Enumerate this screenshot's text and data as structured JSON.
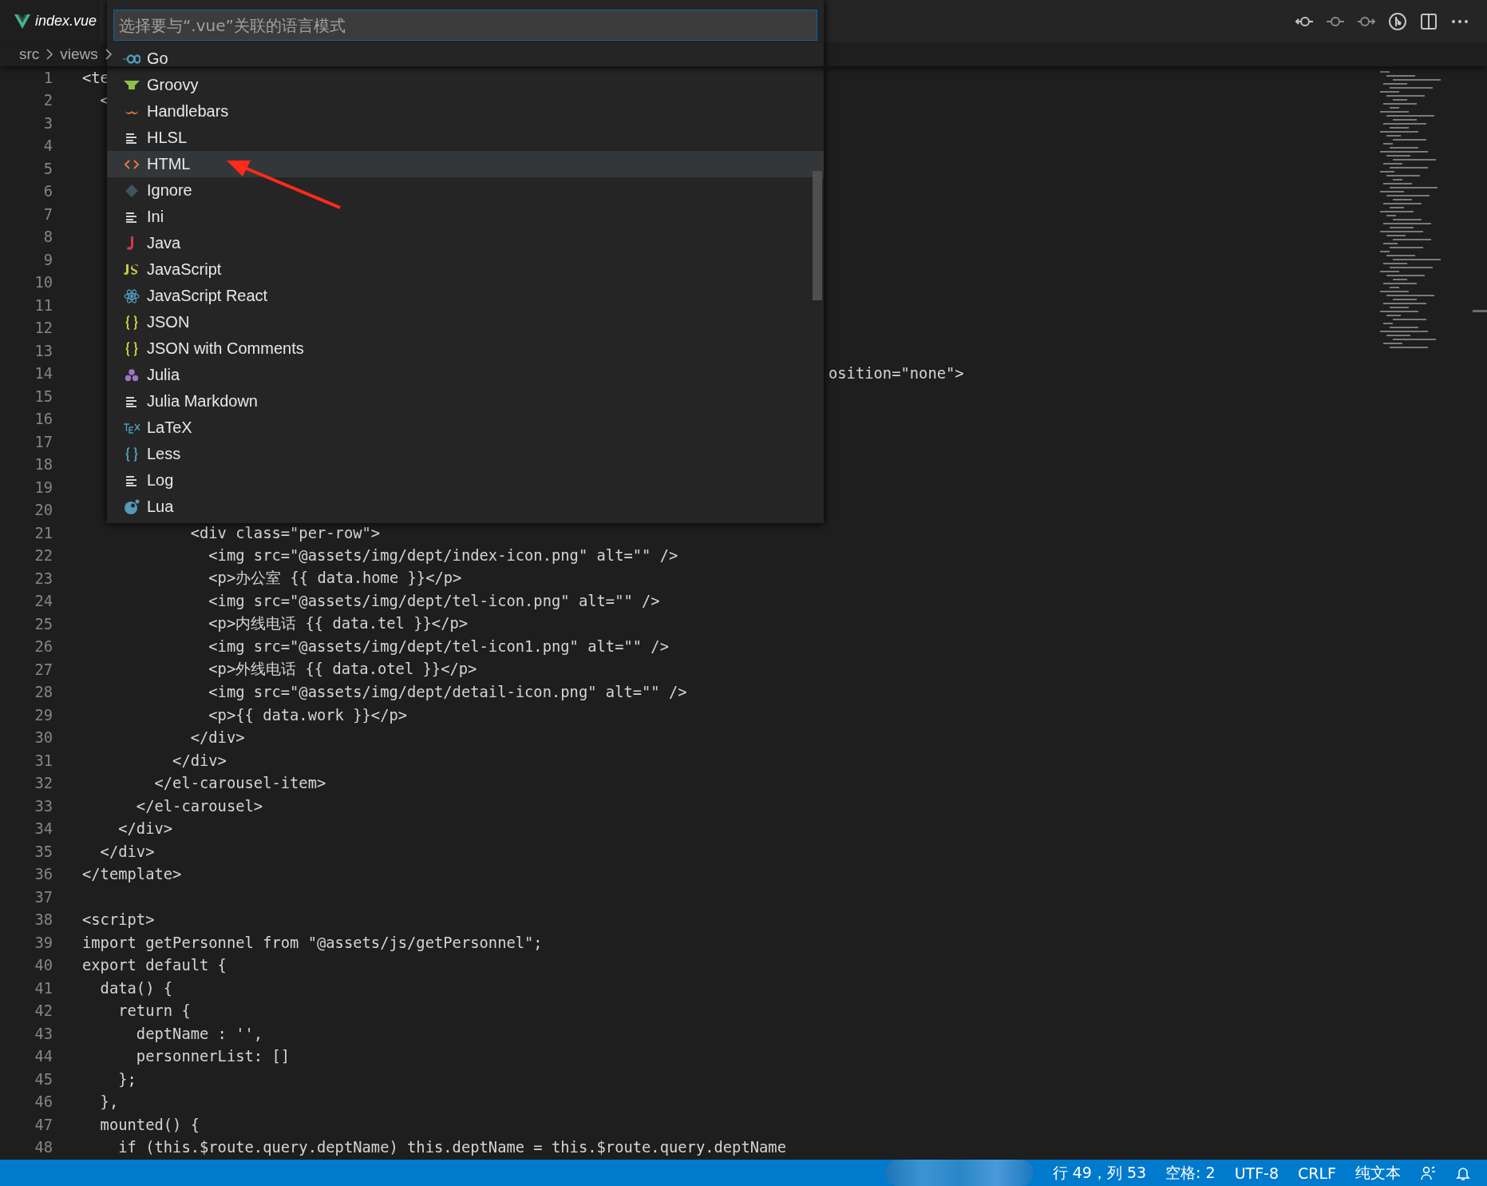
{
  "tab": {
    "title": "index.vue"
  },
  "breadcrumb": [
    "src",
    "views"
  ],
  "language_picker": {
    "placeholder": "选择要与“.vue”关联的语言模式",
    "items": [
      {
        "label": "Go",
        "kind": "go",
        "selected": false
      },
      {
        "label": "Groovy",
        "kind": "groovy",
        "selected": false
      },
      {
        "label": "Handlebars",
        "kind": "handlebars",
        "selected": false
      },
      {
        "label": "HLSL",
        "kind": "lines",
        "selected": false
      },
      {
        "label": "HTML",
        "kind": "html",
        "selected": true
      },
      {
        "label": "Ignore",
        "kind": "git",
        "selected": false
      },
      {
        "label": "Ini",
        "kind": "lines",
        "selected": false
      },
      {
        "label": "Java",
        "kind": "java",
        "selected": false
      },
      {
        "label": "JavaScript",
        "kind": "js",
        "selected": false
      },
      {
        "label": "JavaScript React",
        "kind": "react",
        "selected": false
      },
      {
        "label": "JSON",
        "kind": "json",
        "selected": false
      },
      {
        "label": "JSON with Comments",
        "kind": "json",
        "selected": false
      },
      {
        "label": "Julia",
        "kind": "julia",
        "selected": false
      },
      {
        "label": "Julia Markdown",
        "kind": "lines",
        "selected": false
      },
      {
        "label": "LaTeX",
        "kind": "tex",
        "selected": false
      },
      {
        "label": "Less",
        "kind": "less",
        "selected": false
      },
      {
        "label": "Log",
        "kind": "lines",
        "selected": false
      },
      {
        "label": "Lua",
        "kind": "lua",
        "selected": false
      }
    ]
  },
  "code_lines": [
    {
      "number": "1",
      "text": "<te",
      "kind": "code"
    },
    {
      "number": "2",
      "text": "  <",
      "kind": "code"
    },
    {
      "number": "3"
    },
    {
      "number": "4"
    },
    {
      "number": "5"
    },
    {
      "number": "6"
    },
    {
      "number": "7"
    },
    {
      "number": "8"
    },
    {
      "number": "9"
    },
    {
      "number": "10"
    },
    {
      "number": "11"
    },
    {
      "number": "12"
    },
    {
      "number": "13"
    },
    {
      "number": "14",
      "text": "osition=\"none\">",
      "kind": "after_popup"
    },
    {
      "number": "15"
    },
    {
      "number": "16"
    },
    {
      "number": "17"
    },
    {
      "number": "18"
    },
    {
      "number": "19"
    },
    {
      "number": "20"
    },
    {
      "number": "21",
      "text": "            <div class=\"per-row\">",
      "kind": "code"
    },
    {
      "number": "22",
      "text": "              <img src=\"@assets/img/dept/index-icon.png\" alt=\"\" />",
      "kind": "code"
    },
    {
      "number": "23",
      "text": "              <p>办公室 {{ data.home }}</p>",
      "kind": "code"
    },
    {
      "number": "24",
      "text": "              <img src=\"@assets/img/dept/tel-icon.png\" alt=\"\" />",
      "kind": "code"
    },
    {
      "number": "25",
      "text": "              <p>内线电话 {{ data.tel }}</p>",
      "kind": "code"
    },
    {
      "number": "26",
      "text": "              <img src=\"@assets/img/dept/tel-icon1.png\" alt=\"\" />",
      "kind": "code"
    },
    {
      "number": "27",
      "text": "              <p>外线电话 {{ data.otel }}</p>",
      "kind": "code"
    },
    {
      "number": "28",
      "text": "              <img src=\"@assets/img/dept/detail-icon.png\" alt=\"\" />",
      "kind": "code"
    },
    {
      "number": "29",
      "text": "              <p>{{ data.work }}</p>",
      "kind": "code"
    },
    {
      "number": "30",
      "text": "            </div>",
      "kind": "code"
    },
    {
      "number": "31",
      "text": "          </div>",
      "kind": "code"
    },
    {
      "number": "32",
      "text": "        </el-carousel-item>",
      "kind": "code"
    },
    {
      "number": "33",
      "text": "      </el-carousel>",
      "kind": "code"
    },
    {
      "number": "34",
      "text": "    </div>",
      "kind": "code"
    },
    {
      "number": "35",
      "text": "  </div>",
      "kind": "code"
    },
    {
      "number": "36",
      "text": "</template>",
      "kind": "code"
    },
    {
      "number": "37"
    },
    {
      "number": "38",
      "text": "<script>",
      "kind": "code"
    },
    {
      "number": "39",
      "text": "import getPersonnel from \"@assets/js/getPersonnel\";",
      "kind": "code"
    },
    {
      "number": "40",
      "text": "export default {",
      "kind": "code"
    },
    {
      "number": "41",
      "text": "  data() {",
      "kind": "code"
    },
    {
      "number": "42",
      "text": "    return {",
      "kind": "code"
    },
    {
      "number": "43",
      "text": "      deptName : '',",
      "kind": "code"
    },
    {
      "number": "44",
      "text": "      personnerList: []",
      "kind": "code"
    },
    {
      "number": "45",
      "text": "    };",
      "kind": "code"
    },
    {
      "number": "46",
      "text": "  },",
      "kind": "code"
    },
    {
      "number": "47",
      "text": "  mounted() {",
      "kind": "code"
    },
    {
      "number": "48",
      "text": "    if (this.$route.query.deptName) this.deptName = this.$route.query.deptName",
      "kind": "code"
    }
  ],
  "status_bar": [
    "行 49，列 53",
    "空格: 2",
    "UTF-8",
    "CRLF",
    "纯文本"
  ]
}
